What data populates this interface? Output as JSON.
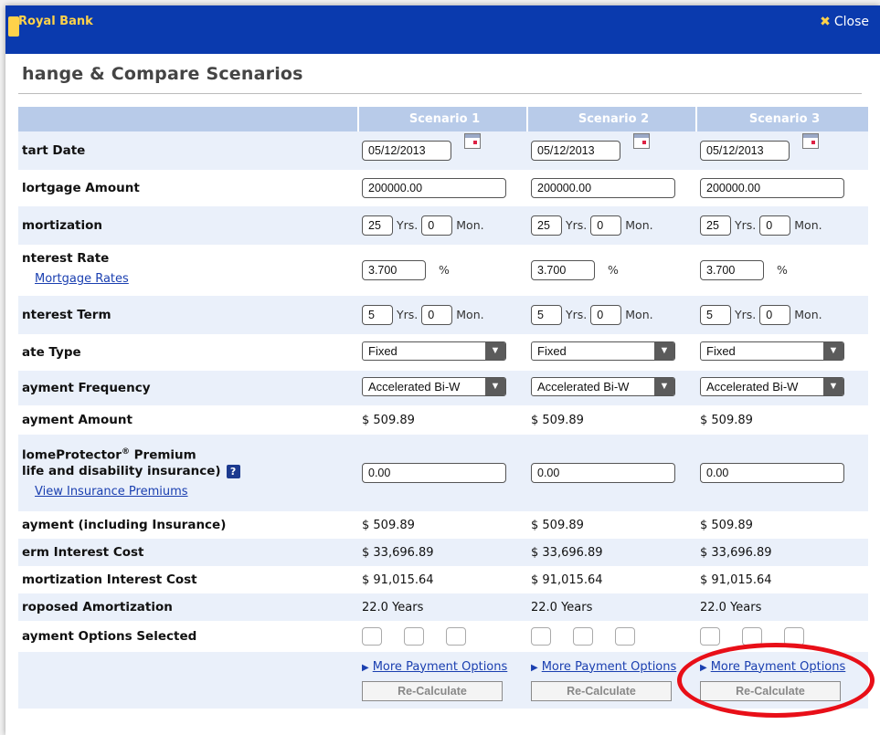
{
  "header": {
    "bank_name": "Royal Bank",
    "close_label": "Close"
  },
  "page_title": "hange & Compare Scenarios",
  "scenarios": [
    "Scenario 1",
    "Scenario 2",
    "Scenario 3"
  ],
  "rows": {
    "start_date": {
      "label": "tart Date",
      "values": [
        "05/12/2013",
        "05/12/2013",
        "05/12/2013"
      ]
    },
    "mortgage_amount": {
      "label": "lortgage Amount",
      "values": [
        "200000.00",
        "200000.00",
        "200000.00"
      ]
    },
    "amortization": {
      "label": "mortization",
      "years": [
        "25",
        "25",
        "25"
      ],
      "months": [
        "0",
        "0",
        "0"
      ],
      "yrs_unit": "Yrs.",
      "mon_unit": "Mon."
    },
    "interest_rate": {
      "label": "nterest Rate",
      "link": "Mortgage Rates",
      "values": [
        "3.700",
        "3.700",
        "3.700"
      ],
      "unit": "%"
    },
    "interest_term": {
      "label": "nterest Term",
      "years": [
        "5",
        "5",
        "5"
      ],
      "months": [
        "0",
        "0",
        "0"
      ],
      "yrs_unit": "Yrs.",
      "mon_unit": "Mon."
    },
    "rate_type": {
      "label": "ate Type",
      "values": [
        "Fixed",
        "Fixed",
        "Fixed"
      ]
    },
    "payment_frequency": {
      "label": "ayment Frequency",
      "values": [
        "Accelerated Bi-W",
        "Accelerated Bi-W",
        "Accelerated Bi-W"
      ]
    },
    "payment_amount": {
      "label": "ayment Amount",
      "values": [
        "$ 509.89",
        "$ 509.89",
        "$ 509.89"
      ]
    },
    "home_protector": {
      "label_line1": "lomeProtector",
      "label_sup": "®",
      "label_line1_end": " Premium",
      "label_line2": "life and disability insurance)",
      "help": "?",
      "link": "View Insurance Premiums",
      "values": [
        "0.00",
        "0.00",
        "0.00"
      ]
    },
    "payment_incl_insurance": {
      "label": "ayment (including Insurance)",
      "values": [
        "$ 509.89",
        "$ 509.89",
        "$ 509.89"
      ]
    },
    "term_interest_cost": {
      "label": "erm Interest Cost",
      "values": [
        "$ 33,696.89",
        "$ 33,696.89",
        "$ 33,696.89"
      ]
    },
    "amortization_interest_cost": {
      "label": "mortization Interest Cost",
      "values": [
        "$ 91,015.64",
        "$ 91,015.64",
        "$ 91,015.64"
      ]
    },
    "proposed_amortization": {
      "label": "roposed Amortization",
      "values": [
        "22.0 Years",
        "22.0 Years",
        "22.0 Years"
      ]
    },
    "payment_options_selected": {
      "label": "ayment Options Selected"
    }
  },
  "more_payment_options": [
    "More Payment Options",
    "More Payment Options",
    "More Payment Options"
  ],
  "recalculate_label": "Re-Calculate",
  "colors": {
    "header_blue": "#0a3aae",
    "table_header": "#b8cbe9",
    "alt_row": "#eaf0fa",
    "highlight": "#e80f18"
  }
}
